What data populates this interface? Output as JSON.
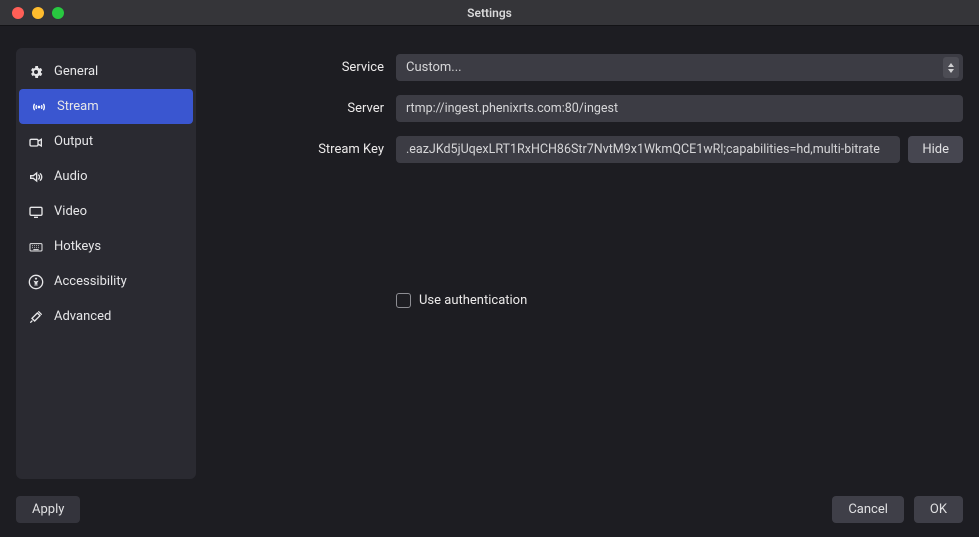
{
  "window": {
    "title": "Settings"
  },
  "sidebar": {
    "items": [
      {
        "label": "General"
      },
      {
        "label": "Stream"
      },
      {
        "label": "Output"
      },
      {
        "label": "Audio"
      },
      {
        "label": "Video"
      },
      {
        "label": "Hotkeys"
      },
      {
        "label": "Accessibility"
      },
      {
        "label": "Advanced"
      }
    ],
    "active_index": 1
  },
  "form": {
    "service": {
      "label": "Service",
      "value": "Custom..."
    },
    "server": {
      "label": "Server",
      "value": "rtmp://ingest.phenixrts.com:80/ingest"
    },
    "stream_key": {
      "label": "Stream Key",
      "value": ".eazJKd5jUqexLRT1RxHCH86Str7NvtM9x1WkmQCE1wRl;capabilities=hd,multi-bitrate",
      "hide_label": "Hide"
    },
    "use_auth": {
      "label": "Use authentication",
      "checked": false
    }
  },
  "footer": {
    "apply": "Apply",
    "cancel": "Cancel",
    "ok": "OK"
  }
}
